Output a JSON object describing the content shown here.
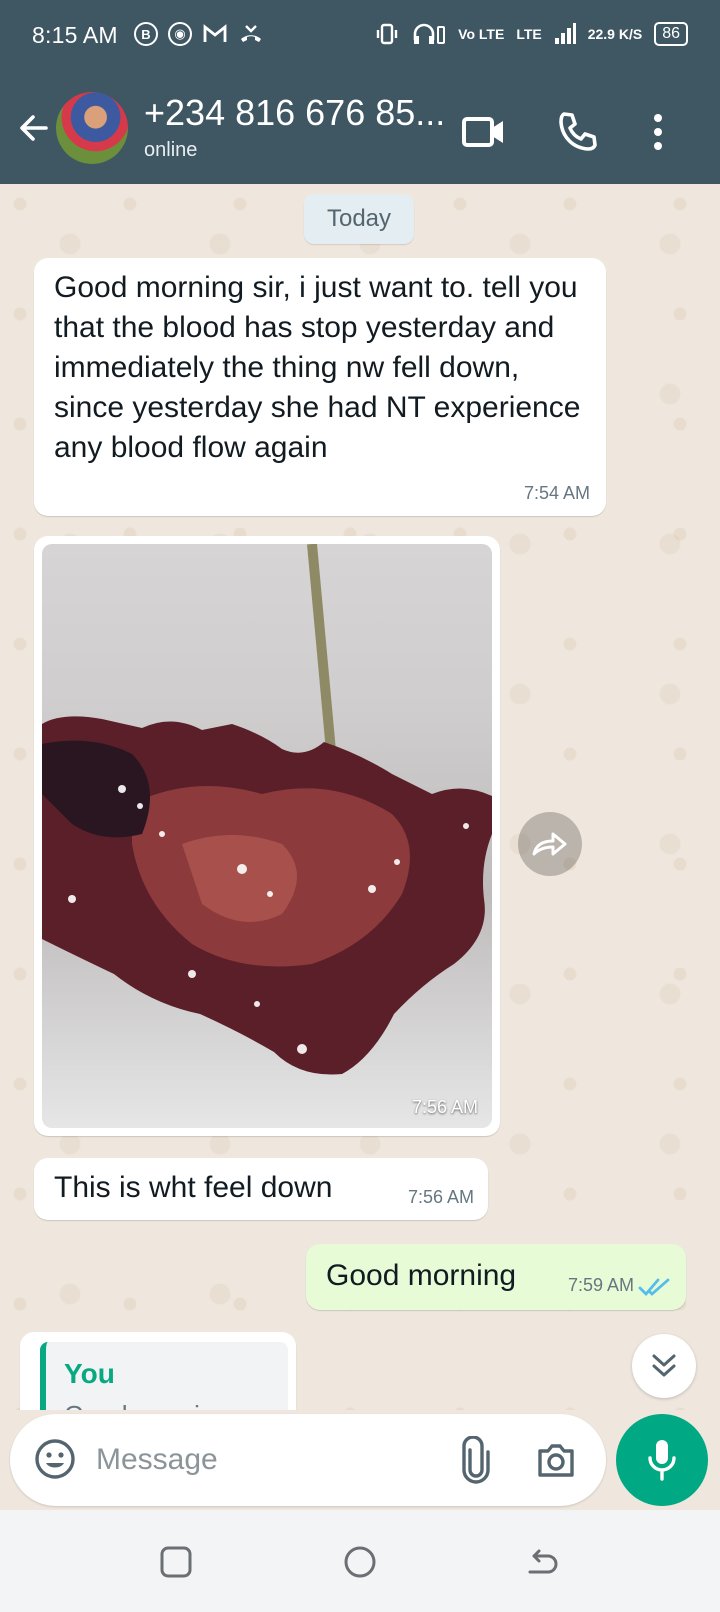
{
  "status_bar": {
    "time": "8:15 AM",
    "icons": [
      "b-icon",
      "chrome-icon",
      "gmail-icon",
      "missed-call-icon"
    ],
    "network": "Vo LTE",
    "lte": "LTE",
    "speed": "22.9 K/S",
    "battery": "86"
  },
  "header": {
    "contact": "+234 816 676 85...",
    "status": "online"
  },
  "chat": {
    "date_label": "Today",
    "messages": [
      {
        "direction": "incoming",
        "text": "Good morning sir, i just want to. tell you that the blood has stop yesterday and immediately the thing nw fell down, since yesterday she had NT experience any blood flow again",
        "time": "7:54 AM"
      },
      {
        "direction": "incoming",
        "type": "image",
        "time": "7:56 AM"
      },
      {
        "direction": "incoming",
        "text": "This is wht feel down",
        "time": "7:56 AM"
      },
      {
        "direction": "outgoing",
        "text": "Good morning",
        "time": "7:59 AM",
        "status": "read"
      },
      {
        "direction": "outgoing",
        "type": "reply",
        "quote_author": "You",
        "quote_text": "Good morning"
      }
    ]
  },
  "composer": {
    "placeholder": "Message"
  },
  "colors": {
    "header": "#3f5663",
    "accent": "#00a884",
    "outgoing_bubble": "#e7fbd6",
    "read_ticks": "#53bdeb"
  }
}
